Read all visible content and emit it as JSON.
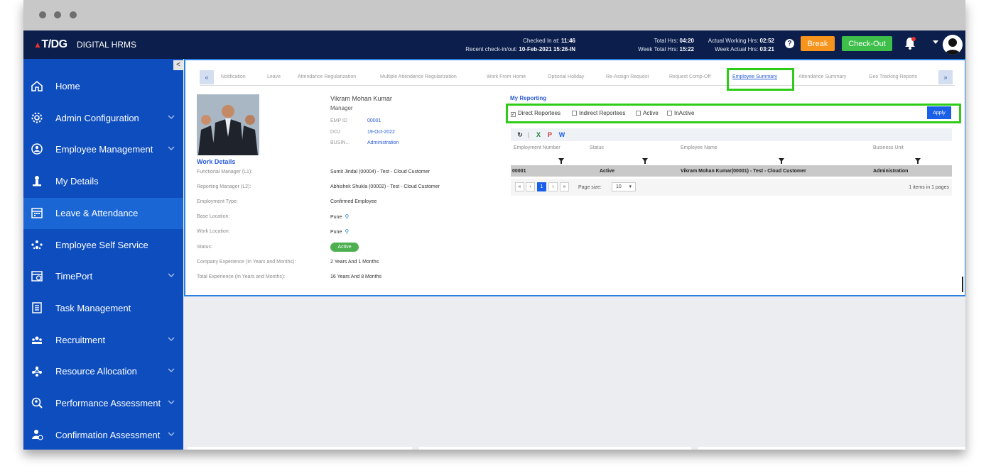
{
  "topbar": {
    "brand": "T/DG",
    "app_name": "DIGITAL HRMS",
    "checked_in_label": "Checked In at:",
    "checked_in_value": "11:46",
    "recent_label": "Recent check-in/out:",
    "recent_value": "10-Feb-2021 15:26-IN",
    "total_hrs_label": "Total Hrs:",
    "total_hrs_value": "04:20",
    "week_total_label": "Week Total Hrs:",
    "week_total_value": "15:22",
    "actual_working_label": "Actual Working Hrs:",
    "actual_working_value": "02:52",
    "week_actual_label": "Week Actual Hrs:",
    "week_actual_value": "03:21",
    "help": "?",
    "break_label": "Break",
    "checkout_label": "Check-Out"
  },
  "sidebar": {
    "collapse": "<",
    "items": [
      {
        "label": "Home",
        "icon": "home-icon",
        "expand": false
      },
      {
        "label": "Admin Configuration",
        "icon": "gear-icon",
        "expand": true
      },
      {
        "label": "Employee Management",
        "icon": "employee-icon",
        "expand": true
      },
      {
        "label": "My Details",
        "icon": "person-icon",
        "expand": false
      },
      {
        "label": "Leave & Attendance",
        "icon": "calendar-icon",
        "expand": false,
        "active": true
      },
      {
        "label": "Employee Self Service",
        "icon": "self-service-icon",
        "expand": false
      },
      {
        "label": "TimePort",
        "icon": "timeport-icon",
        "expand": true
      },
      {
        "label": "Task Management",
        "icon": "checklist-icon",
        "expand": false
      },
      {
        "label": "Recruitment",
        "icon": "recruitment-icon",
        "expand": true
      },
      {
        "label": "Resource Allocation",
        "icon": "resource-icon",
        "expand": true
      },
      {
        "label": "Performance Assessment",
        "icon": "performance-icon",
        "expand": true
      },
      {
        "label": "Confirmation Assessment",
        "icon": "confirmation-icon",
        "expand": true
      }
    ]
  },
  "tabs": {
    "prev": "«",
    "next": "»",
    "items": [
      "Notification",
      "Leave",
      "Attendance Regularization",
      "Multiple Attendance Regularization",
      "Work From Home",
      "Optional Holiday",
      "Re-Assign Request",
      "Request Comp-Off",
      "Employee Summary",
      "Attendance Summary",
      "Geo Tracking Reports"
    ],
    "active": "Employee Summary"
  },
  "employee": {
    "name": "Vikram Mohan Kumar",
    "role": "Manager",
    "emp_id_label": "EMP ID",
    "emp_id": "00001",
    "doj_label": "DOJ",
    "doj": "19-Oct-2022",
    "busin_label": "BUSIN...",
    "busin": "Administration"
  },
  "work_details": {
    "title": "Work Details",
    "rows": [
      {
        "label": "Functional Manager (L1):",
        "value": "Sumit Jindal (00004) - Test - Cloud Customer"
      },
      {
        "label": "Reporting Manager (L2):",
        "value": "Abhishek Shukla (00002) - Test - Cloud Customer"
      },
      {
        "label": "Employment Type:",
        "value": "Confirmed Employee"
      },
      {
        "label": "Base Location:",
        "value": "Pune"
      },
      {
        "label": "Work Location:",
        "value": "Pune"
      },
      {
        "label": "Status:",
        "value": "Active"
      },
      {
        "label": "Company Experience (In Years and Months):",
        "value": "2 Years And 1 Months"
      },
      {
        "label": "Total Experience (In Years and Months):",
        "value": "16 Years And 8 Months"
      }
    ]
  },
  "reporting": {
    "title": "My Reporting",
    "filters": {
      "direct": "Direct Reportees",
      "indirect": "Indirect Reportees",
      "active": "Active",
      "inactive": "InActive"
    },
    "apply_label": "Apply",
    "columns": [
      "Employment Number",
      "Status",
      "Employee Name",
      "Business Unit"
    ],
    "rows": [
      {
        "number": "00001",
        "status": "Active",
        "name": "Vikram Mohan Kumar(00001) - Test - Cloud Customer",
        "unit": "Administration"
      }
    ],
    "pager": {
      "first": "«",
      "prev": "‹",
      "current": "1",
      "next": "›",
      "last": "»",
      "page_size_label": "Page size:",
      "page_size": "10",
      "info": "1 items in 1 pages"
    }
  },
  "colors": {
    "topbar": "#0b1e4c",
    "sidebar": "#0d4dbe",
    "sidebar_active": "#1a66d4",
    "break": "#f7941d",
    "checkout": "#3dbf4a",
    "highlight": "#2ecc19",
    "link": "#2a5bd7"
  }
}
